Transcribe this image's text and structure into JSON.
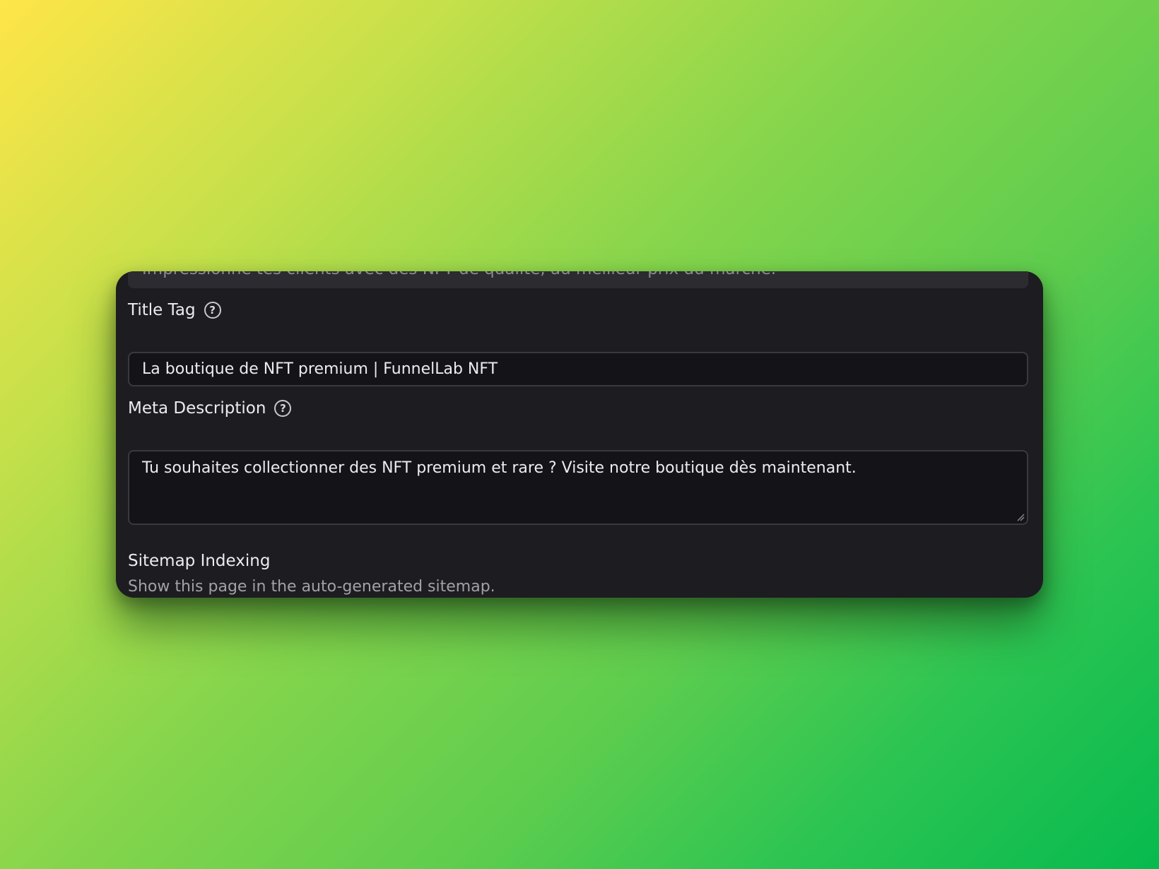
{
  "top_field": {
    "value": "Impressionne tes clients avec des NFT de qualité, au meilleur prix du marché."
  },
  "title_tag": {
    "label": "Title Tag",
    "help_icon": "question-circle-icon",
    "help_glyph": "?",
    "value": "La boutique de NFT premium | FunnelLab NFT"
  },
  "meta_description": {
    "label": "Meta Description",
    "help_icon": "question-circle-icon",
    "help_glyph": "?",
    "value": "Tu souhaites collectionner des NFT premium et rare ? Visite notre boutique dès maintenant."
  },
  "sitemap": {
    "title": "Sitemap Indexing",
    "description": "Show this page in the auto-generated sitemap."
  },
  "colors": {
    "panel_bg": "#1d1c20",
    "input_bg": "#141317",
    "text_primary": "#ececef",
    "text_secondary": "#a2a1a7",
    "gradient_start": "#ffe548",
    "gradient_end": "#07ba4e"
  }
}
